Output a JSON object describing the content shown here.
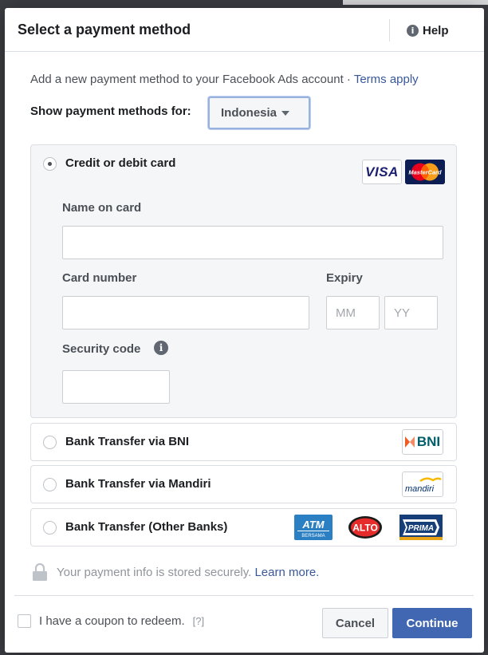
{
  "dialog": {
    "title": "Select a payment method",
    "help_label": "Help",
    "help_icon": "info-icon"
  },
  "intro": {
    "text": "Add a new payment method to your Facebook Ads account · ",
    "terms_link": "Terms apply"
  },
  "country": {
    "label": "Show payment methods for:",
    "selected": "Indonesia"
  },
  "card": {
    "option_label": "Credit or debit card",
    "selected": true,
    "logos": [
      "VISA",
      "MasterCard"
    ],
    "name_label": "Name on card",
    "name_value": "",
    "number_label": "Card number",
    "number_value": "",
    "expiry_label": "Expiry",
    "expiry_month_placeholder": "MM",
    "expiry_year_placeholder": "YY",
    "security_label": "Security code",
    "security_value": ""
  },
  "banks": [
    {
      "label": "Bank Transfer via BNI",
      "logo": "BNI"
    },
    {
      "label": "Bank Transfer via Mandiri",
      "logo": "mandiri"
    },
    {
      "label": "Bank Transfer (Other Banks)",
      "logos": [
        "ATM BERSAMA",
        "ALTO",
        "PRIMA"
      ]
    }
  ],
  "logo_text": {
    "atm": "ATM",
    "bersama": "BERSAMA",
    "alto": "ALTO",
    "prima": "PRIMA",
    "bni": "BNI",
    "mandiri": "mandiri"
  },
  "secure": {
    "text": "Your payment info is stored securely. ",
    "learn_more": "Learn more."
  },
  "footer": {
    "coupon_label": "I have a coupon to redeem.",
    "coupon_help": "[?]",
    "cancel_label": "Cancel",
    "continue_label": "Continue"
  },
  "colors": {
    "primary": "#4267b2",
    "link": "#385898",
    "panel_bg": "#f5f6f7",
    "border": "#dadde1"
  }
}
